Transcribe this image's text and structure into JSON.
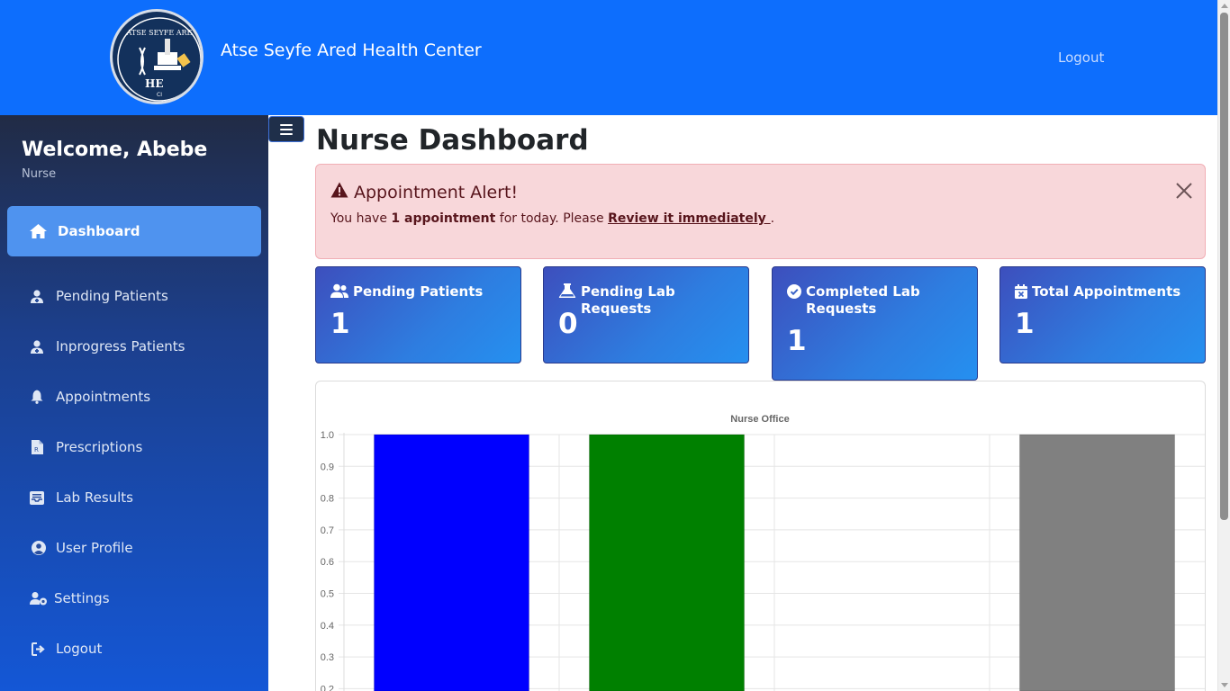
{
  "header": {
    "brand": "Atse Seyfe Ared Health Center",
    "logo_text": "ATSE SEYFE ARE",
    "logo_initials": "HE",
    "logo_sub": "CI",
    "logout": "Logout",
    "color": "#0d6efd"
  },
  "sidebar": {
    "welcome": "Welcome, Abebe",
    "role": "Nurse",
    "items": [
      {
        "label": "Dashboard",
        "icon": "home-icon",
        "active": true
      },
      {
        "label": "Pending Patients",
        "icon": "user-nurse-icon"
      },
      {
        "label": "Inprogress Patients",
        "icon": "user-nurse-icon"
      },
      {
        "label": "Appointments",
        "icon": "bell-icon"
      },
      {
        "label": "Prescriptions",
        "icon": "file-prescription-icon"
      },
      {
        "label": "Lab Results",
        "icon": "inbox-icon"
      },
      {
        "label": "User Profile",
        "icon": "user-circle-icon"
      },
      {
        "label": "Settings",
        "icon": "users-cog-icon"
      },
      {
        "label": "Logout",
        "icon": "sign-out-icon"
      }
    ]
  },
  "main": {
    "title": "Nurse Dashboard",
    "alert": {
      "title": "Appointment Alert!",
      "text_before": "You have ",
      "count_text": "1 appointment",
      "text_mid": " for today. Please ",
      "link": "Review it immediately ",
      "text_after": "."
    },
    "cards": [
      {
        "title": "Pending Patients",
        "value": "1",
        "icon": "users-icon"
      },
      {
        "title": "Pending Lab Requests",
        "value": "0",
        "icon": "flask-icon"
      },
      {
        "title": "Completed Lab Requests",
        "value": "1",
        "icon": "check-circle-icon"
      },
      {
        "title": "Total Appointments",
        "value": "1",
        "icon": "calendar-x-icon"
      }
    ]
  },
  "chart_data": {
    "type": "bar",
    "title": "Nurse Office",
    "categories": [
      "",
      "",
      "",
      ""
    ],
    "values": [
      1,
      1,
      0,
      1
    ],
    "colors": [
      "#0000ff",
      "#008000",
      "#ffa500",
      "#808080"
    ],
    "ylim": [
      0,
      1.0
    ],
    "yticks": [
      "1.0",
      "0.9",
      "0.8",
      "0.7",
      "0.6",
      "0.5",
      "0.4",
      "0.3",
      "0.2"
    ],
    "xlabel": "",
    "ylabel": "",
    "grid": true
  }
}
